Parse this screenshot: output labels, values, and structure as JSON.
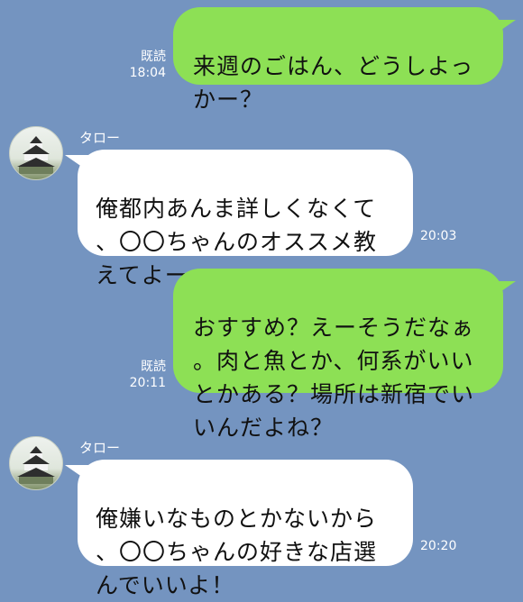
{
  "messages": [
    {
      "text": "来週のごはん、どうしよっ\nかー？",
      "read": "既読",
      "time": "18:04"
    },
    {
      "sender": "タロー",
      "text": "俺都内あんま詳しくなくて\n、〇〇ちゃんのオススメ教\nえてよー",
      "time": "20:03"
    },
    {
      "text": "おすすめ？えーそうだなぁ\n。肉と魚とか、何系がいい\nとかある？場所は新宿でい\nいんだよね？",
      "read": "既読",
      "time": "20:11"
    },
    {
      "sender": "タロー",
      "text": "俺嫌いなものとかないから\n、〇〇ちゃんの好きな店選\nんでいいよ！",
      "time": "20:20"
    }
  ],
  "icons": {
    "avatar": "castle-avatar-icon"
  },
  "colors": {
    "background": "#7494c0",
    "outgoing": "#8de055",
    "incoming": "#ffffff"
  }
}
